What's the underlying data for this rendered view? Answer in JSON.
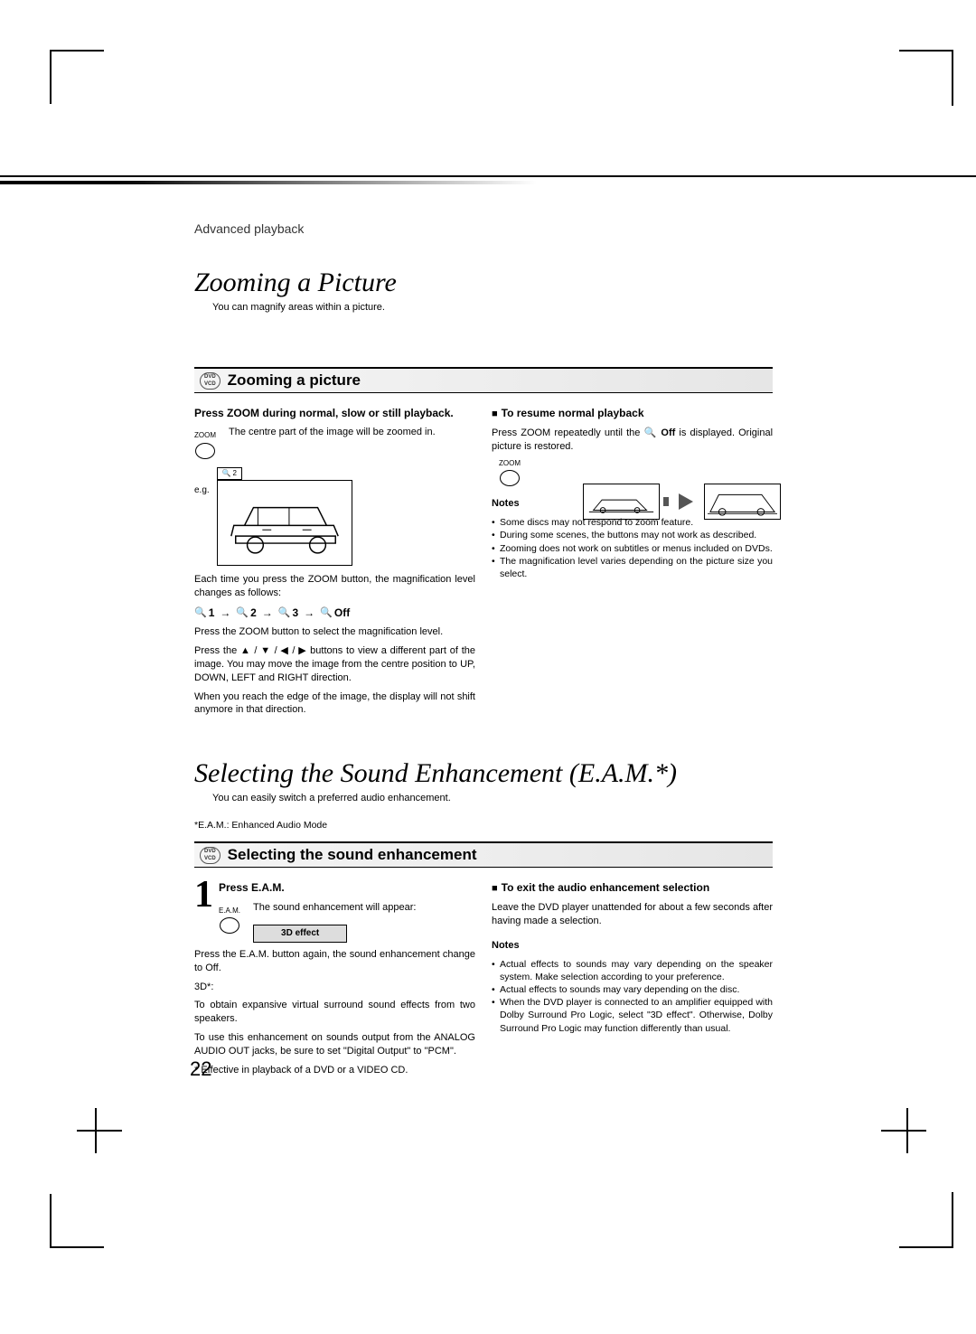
{
  "breadcrumb": "Advanced playback",
  "section1": {
    "title": "Zooming a Picture",
    "subtitle": "You can magnify areas within a picture.",
    "band_title": "Zooming a picture",
    "left": {
      "instr_bold": "Press ZOOM during normal, slow or still playback.",
      "btn_label": "ZOOM",
      "zoom_effect": "The centre part of the image will be zoomed in.",
      "eg_label": "e.g.",
      "eg_box": "2",
      "each_time": "Each time you press the ZOOM button, the magnification level changes as follows:",
      "seq": [
        "1",
        "2",
        "3",
        "Off"
      ],
      "p_select": "Press the ZOOM button to select the magnification level.",
      "p_move": "Press the ▲ / ▼ / ◀ / ▶ buttons to view a different part of the image. You may move the image from the centre position to UP, DOWN, LEFT and RIGHT direction.",
      "p_edge": "When you reach the edge of the image, the display will not shift anymore in that direction."
    },
    "right": {
      "resume_h": "To resume normal playback",
      "resume_p_a": "Press ZOOM repeatedly until the ",
      "resume_off": "Off",
      "resume_p_b": " is displayed. Original picture is restored.",
      "btn_label": "ZOOM",
      "notes_h": "Notes",
      "notes": [
        "Some discs may not respond to zoom feature.",
        "During some scenes, the buttons may not work as described.",
        "Zooming does not work on subtitles or menus included on DVDs.",
        "The magnification level varies depending on the picture size you select."
      ]
    }
  },
  "section2": {
    "title": "Selecting the Sound Enhancement (E.A.M.*)",
    "subtitle": "You can easily switch a preferred audio enhancement.",
    "footnote": "*E.A.M.: Enhanced Audio Mode",
    "band_title": "Selecting the sound enhancement",
    "left": {
      "step_num": "1",
      "step_h": "Press E.A.M.",
      "btn_label": "E.A.M.",
      "appear": "The sound enhancement will appear:",
      "osd": "3D effect",
      "press_again": "Press the E.A.M. button again, the sound enhancement change to Off.",
      "threeD_h": "3D*:",
      "threeD_p": "To obtain expansive virtual surround sound effects from two speakers.",
      "analog": "To use this enhancement on sounds output from the ANALOG AUDIO OUT jacks, be sure to set \"Digital Output\" to \"PCM\".",
      "effective": "* Effective in playback of a DVD or a VIDEO CD."
    },
    "right": {
      "exit_h": "To exit the audio enhancement selection",
      "exit_p": "Leave the DVD player unattended for about a few seconds after having made a selection.",
      "notes_h": "Notes",
      "notes": [
        "Actual effects to sounds may vary depending on the speaker system. Make selection according to your preference.",
        "Actual effects to sounds may vary depending on the disc.",
        "When the DVD player is connected to an amplifier equipped with Dolby Surround Pro Logic, select \"3D effect\". Otherwise, Dolby Surround Pro Logic may function differently than usual."
      ]
    }
  },
  "disc_badge": {
    "top": "DVD",
    "bot": "VCD"
  },
  "page_number": "22"
}
